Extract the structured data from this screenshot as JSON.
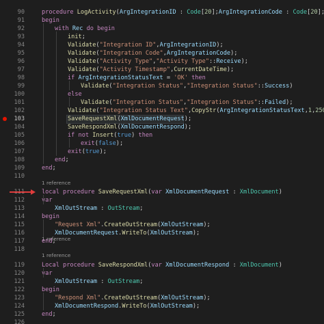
{
  "editor": {
    "accent": "#c586c0",
    "breakpoint_color": "#e51400",
    "arrow_color": "#e03c3c",
    "lens": [
      "1 reference",
      "1 reference",
      "1 reference"
    ],
    "lines": [
      {
        "n": "90",
        "indent": 0,
        "tokens": [
          [
            "k",
            "procedure "
          ],
          [
            "f",
            "LogActivity"
          ],
          [
            "p",
            "("
          ],
          [
            "v",
            "ArgIntegrationID"
          ],
          [
            "p",
            " : "
          ],
          [
            "t",
            "Code"
          ],
          [
            "p",
            "["
          ],
          [
            "n",
            "20"
          ],
          [
            "p",
            "];"
          ],
          [
            "v",
            "ArgIntegrationCode"
          ],
          [
            "p",
            " : "
          ],
          [
            "t",
            "Code"
          ],
          [
            "p",
            "["
          ],
          [
            "n",
            "20"
          ],
          [
            "p",
            "];"
          ],
          [
            "v",
            "Arg"
          ]
        ]
      },
      {
        "n": "91",
        "indent": 0,
        "tokens": [
          [
            "k",
            "begin"
          ]
        ]
      },
      {
        "n": "92",
        "indent": 1,
        "tokens": [
          [
            "k",
            "with "
          ],
          [
            "v",
            "Rec "
          ],
          [
            "k",
            "do begin"
          ]
        ]
      },
      {
        "n": "93",
        "indent": 2,
        "tokens": [
          [
            "f",
            "init"
          ],
          [
            "p",
            ";"
          ]
        ]
      },
      {
        "n": "94",
        "indent": 2,
        "tokens": [
          [
            "f",
            "Validate"
          ],
          [
            "p",
            "("
          ],
          [
            "s",
            "\"Integration ID\""
          ],
          [
            "p",
            ","
          ],
          [
            "v",
            "ArgIntegrationID"
          ],
          [
            "p",
            ");"
          ]
        ]
      },
      {
        "n": "95",
        "indent": 2,
        "tokens": [
          [
            "f",
            "Validate"
          ],
          [
            "p",
            "("
          ],
          [
            "s",
            "\"Integration Code\""
          ],
          [
            "p",
            ","
          ],
          [
            "v",
            "ArgIntegrationCode"
          ],
          [
            "p",
            ");"
          ]
        ]
      },
      {
        "n": "96",
        "indent": 2,
        "tokens": [
          [
            "f",
            "Validate"
          ],
          [
            "p",
            "("
          ],
          [
            "s",
            "\"Activity Type\""
          ],
          [
            "p",
            ","
          ],
          [
            "s",
            "\"Activity Type\""
          ],
          [
            "p",
            "::"
          ],
          [
            "v",
            "Receive"
          ],
          [
            "p",
            ");"
          ]
        ]
      },
      {
        "n": "97",
        "indent": 2,
        "tokens": [
          [
            "f",
            "Validate"
          ],
          [
            "p",
            "("
          ],
          [
            "s",
            "\"Activity Timestamp\""
          ],
          [
            "p",
            ","
          ],
          [
            "f",
            "CurrentDateTime"
          ],
          [
            "p",
            ");"
          ]
        ]
      },
      {
        "n": "98",
        "indent": 2,
        "tokens": [
          [
            "k",
            "if "
          ],
          [
            "v",
            "ArgIntegrationStatusText"
          ],
          [
            "p",
            " = "
          ],
          [
            "s",
            "'OK'"
          ],
          [
            "k",
            " then"
          ]
        ]
      },
      {
        "n": "99",
        "indent": 3,
        "tokens": [
          [
            "f",
            "Validate"
          ],
          [
            "p",
            "("
          ],
          [
            "s",
            "\"Integration Status\""
          ],
          [
            "p",
            ","
          ],
          [
            "s",
            "\"Integration Status\""
          ],
          [
            "p",
            "::"
          ],
          [
            "v",
            "Success"
          ],
          [
            "p",
            ")"
          ]
        ]
      },
      {
        "n": "100",
        "indent": 2,
        "tokens": [
          [
            "k",
            "else"
          ]
        ]
      },
      {
        "n": "101",
        "indent": 3,
        "tokens": [
          [
            "f",
            "Validate"
          ],
          [
            "p",
            "("
          ],
          [
            "s",
            "\"Integration Status\""
          ],
          [
            "p",
            ","
          ],
          [
            "s",
            "\"Integration Status\""
          ],
          [
            "p",
            "::"
          ],
          [
            "v",
            "Failed"
          ],
          [
            "p",
            ");"
          ]
        ]
      },
      {
        "n": "102",
        "indent": 2,
        "tokens": [
          [
            "f",
            "Validate"
          ],
          [
            "p",
            "("
          ],
          [
            "s",
            "\"Integration Status Text\""
          ],
          [
            "p",
            ","
          ],
          [
            "f",
            "CopyStr"
          ],
          [
            "p",
            "("
          ],
          [
            "v",
            "ArgIntegrationStatusText"
          ],
          [
            "p",
            ","
          ],
          [
            "n",
            "1"
          ],
          [
            "p",
            ","
          ],
          [
            "n",
            "250"
          ],
          [
            "p",
            "));"
          ]
        ]
      },
      {
        "n": "103",
        "indent": 2,
        "tokens": [
          [
            "f",
            "SaveRequestXml"
          ],
          [
            "p",
            "("
          ],
          [
            "v",
            "XmlDocumentRequest"
          ],
          [
            "p",
            ");"
          ]
        ]
      },
      {
        "n": "104",
        "indent": 2,
        "tokens": [
          [
            "f",
            "SaveRespondXml"
          ],
          [
            "p",
            "("
          ],
          [
            "v",
            "XmlDocumentRespond"
          ],
          [
            "p",
            ");"
          ]
        ]
      },
      {
        "n": "105",
        "indent": 2,
        "tokens": [
          [
            "k",
            "if not "
          ],
          [
            "f",
            "Insert"
          ],
          [
            "p",
            "("
          ],
          [
            "kb",
            "true"
          ],
          [
            "p",
            ") "
          ],
          [
            "k",
            "then"
          ]
        ]
      },
      {
        "n": "106",
        "indent": 3,
        "tokens": [
          [
            "k",
            "exit"
          ],
          [
            "p",
            "("
          ],
          [
            "kb",
            "false"
          ],
          [
            "p",
            ");"
          ]
        ]
      },
      {
        "n": "107",
        "indent": 2,
        "tokens": [
          [
            "k",
            "exit"
          ],
          [
            "p",
            "("
          ],
          [
            "kb",
            "true"
          ],
          [
            "p",
            ");"
          ]
        ]
      },
      {
        "n": "108",
        "indent": 1,
        "tokens": [
          [
            "k",
            "end"
          ],
          [
            "p",
            ";"
          ]
        ]
      },
      {
        "n": "109",
        "indent": 0,
        "tokens": [
          [
            "k",
            "end"
          ],
          [
            "p",
            ";"
          ]
        ]
      },
      {
        "n": "110",
        "indent": 0,
        "tokens": []
      },
      {
        "n": "111",
        "indent": 0,
        "tokens": [
          [
            "k",
            "local procedure "
          ],
          [
            "f",
            "SaveRequestXml"
          ],
          [
            "p",
            "("
          ],
          [
            "k",
            "var "
          ],
          [
            "v",
            "XmlDocumentRequest"
          ],
          [
            "p",
            " : "
          ],
          [
            "t",
            "XmlDocument"
          ],
          [
            "p",
            ")"
          ]
        ]
      },
      {
        "n": "112",
        "indent": 0,
        "tokens": [
          [
            "k",
            "var"
          ]
        ]
      },
      {
        "n": "113",
        "indent": 1,
        "tokens": [
          [
            "v",
            "XmlOutStream"
          ],
          [
            "p",
            " : "
          ],
          [
            "t",
            "OutStream"
          ],
          [
            "p",
            ";"
          ]
        ]
      },
      {
        "n": "114",
        "indent": 0,
        "tokens": [
          [
            "k",
            "begin"
          ]
        ]
      },
      {
        "n": "115",
        "indent": 1,
        "tokens": [
          [
            "s",
            "\"Request Xml\""
          ],
          [
            "p",
            "."
          ],
          [
            "f",
            "CreateOutStream"
          ],
          [
            "p",
            "("
          ],
          [
            "v",
            "XmlOutStream"
          ],
          [
            "p",
            ");"
          ]
        ]
      },
      {
        "n": "116",
        "indent": 1,
        "tokens": [
          [
            "v",
            "XmlDocumentRequest"
          ],
          [
            "p",
            "."
          ],
          [
            "f",
            "WriteTo"
          ],
          [
            "p",
            "("
          ],
          [
            "v",
            "XmlOutStream"
          ],
          [
            "p",
            ");"
          ]
        ]
      },
      {
        "n": "117",
        "indent": 0,
        "tokens": [
          [
            "k",
            "end"
          ],
          [
            "p",
            ";"
          ]
        ]
      },
      {
        "n": "118",
        "indent": 0,
        "tokens": []
      },
      {
        "n": "119",
        "indent": 0,
        "tokens": [
          [
            "k",
            "Local procedure "
          ],
          [
            "f",
            "SaveRespondXml"
          ],
          [
            "p",
            "("
          ],
          [
            "k",
            "var "
          ],
          [
            "v",
            "XmlDocumentRespond"
          ],
          [
            "p",
            " : "
          ],
          [
            "t",
            "XmlDocument"
          ],
          [
            "p",
            ")"
          ]
        ]
      },
      {
        "n": "120",
        "indent": 0,
        "tokens": [
          [
            "k",
            "var"
          ]
        ]
      },
      {
        "n": "121",
        "indent": 1,
        "tokens": [
          [
            "v",
            "XmlOutStream"
          ],
          [
            "p",
            " : "
          ],
          [
            "t",
            "OutStream"
          ],
          [
            "p",
            ";"
          ]
        ]
      },
      {
        "n": "122",
        "indent": 0,
        "tokens": [
          [
            "k",
            "begin"
          ]
        ]
      },
      {
        "n": "123",
        "indent": 1,
        "tokens": [
          [
            "s",
            "\"Respond Xml\""
          ],
          [
            "p",
            "."
          ],
          [
            "f",
            "CreateOutStream"
          ],
          [
            "p",
            "("
          ],
          [
            "v",
            "XmlOutStream"
          ],
          [
            "p",
            ");"
          ]
        ]
      },
      {
        "n": "124",
        "indent": 1,
        "tokens": [
          [
            "v",
            "XmlDocumentRespond"
          ],
          [
            "p",
            "."
          ],
          [
            "f",
            "WriteTo"
          ],
          [
            "p",
            "("
          ],
          [
            "v",
            "XmlOutStream"
          ],
          [
            "p",
            ");"
          ]
        ]
      },
      {
        "n": "125",
        "indent": 0,
        "tokens": [
          [
            "k",
            "end"
          ],
          [
            "p",
            ";"
          ]
        ]
      },
      {
        "n": "126",
        "indent": 0,
        "tokens": []
      }
    ]
  }
}
